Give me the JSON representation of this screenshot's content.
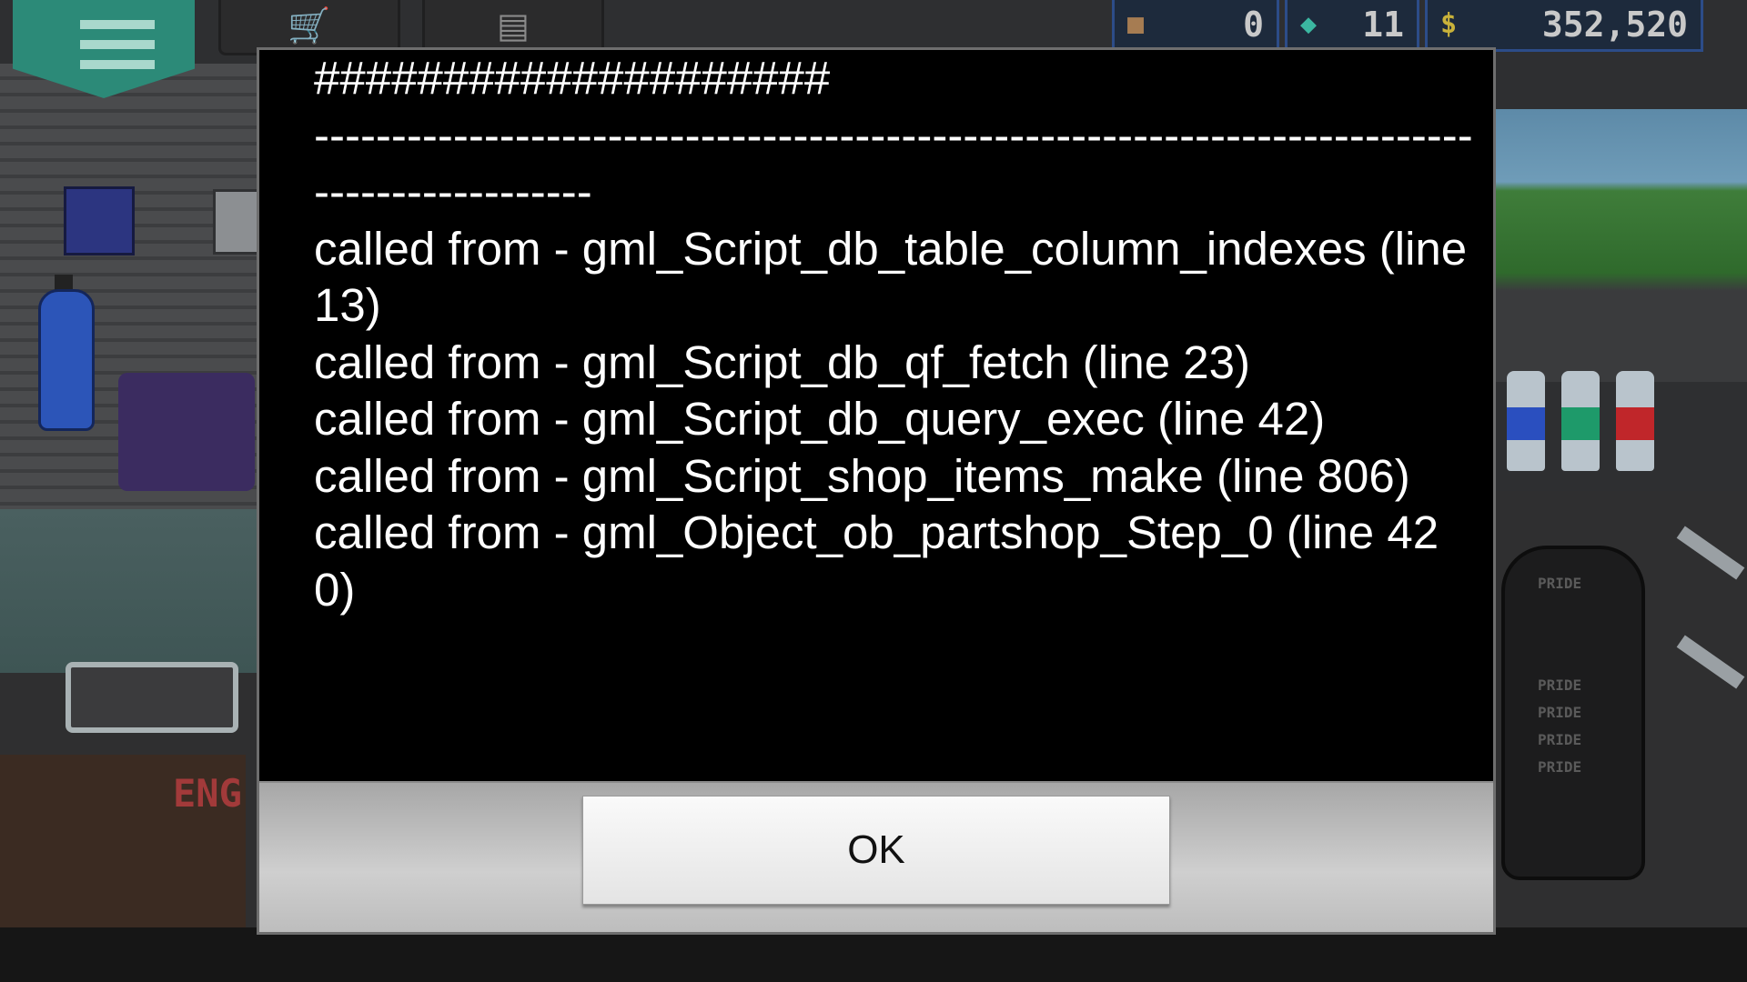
{
  "hud": {
    "menu_icon": "hamburger-menu-icon",
    "shop_icon": "shopping-cart-icon",
    "garage_icon": "garage-door-icon",
    "currencies": [
      {
        "icon": "crate-icon",
        "value": "0"
      },
      {
        "icon": "diamond-icon",
        "value": "11"
      },
      {
        "icon": "dollar-icon",
        "symbol": "$",
        "value": "352,520"
      }
    ]
  },
  "scene": {
    "left_sign": "ENG",
    "seat_brand": "PRIDE",
    "can_colors": [
      "#2a4fbf",
      "#1e9a6a",
      "#c0262a"
    ]
  },
  "dialog": {
    "message_lines": [
      "####################",
      "---------------------------------------------------------------------------------------------",
      "called from - gml_Script_db_table_column_indexes (line 13)",
      "called from - gml_Script_db_qf_fetch (line 23)",
      "called from - gml_Script_db_query_exec (line 42)",
      "called from - gml_Script_shop_items_make (line 806)",
      "called from - gml_Object_ob_partshop_Step_0 (line 420)"
    ],
    "ok_label": "OK"
  }
}
